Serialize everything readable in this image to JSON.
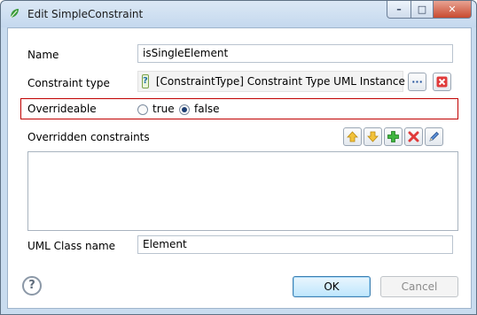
{
  "window": {
    "title": "Edit SimpleConstraint",
    "controls": {
      "minimize": "–",
      "maximize": "□",
      "close": "✕"
    }
  },
  "form": {
    "name_label": "Name",
    "name_value": "isSingleElement",
    "constraint_type_label": "Constraint type",
    "constraint_type_value": "[ConstraintType] Constraint Type UML Instance Of",
    "constraint_type_icon": "?",
    "overrideable_label": "Overrideable",
    "overrideable_options": [
      {
        "label": "true",
        "selected": false
      },
      {
        "label": "false",
        "selected": true
      }
    ],
    "overridden_label": "Overridden constraints",
    "overridden_items": [],
    "uml_class_label": "UML Class name",
    "uml_class_value": "Element"
  },
  "buttons": {
    "help": "?",
    "ok": "OK",
    "cancel": "Cancel",
    "browse": "···"
  },
  "colors": {
    "highlight_border": "#c00000",
    "title_bar": "#c4d8ee"
  }
}
